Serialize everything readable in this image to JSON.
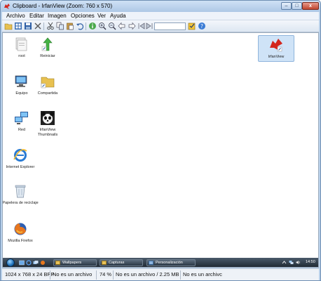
{
  "window": {
    "title": "Clipboard - IrfanView (Zoom: 760 x 570)",
    "controls": {
      "minimize": "–",
      "maximize": "□",
      "close": "x"
    }
  },
  "menu": [
    "Archivo",
    "Editar",
    "Imagen",
    "Opciones",
    "Ver",
    "Ayuda"
  ],
  "toolbar": {
    "buttons": [
      "open-folder",
      "thumbnails",
      "save",
      "delete",
      "cut",
      "copy",
      "paste",
      "undo",
      "info",
      "zoom-in",
      "zoom-out",
      "previous",
      "next",
      "first",
      "last",
      "options",
      "help"
    ],
    "field_value": ""
  },
  "desktop": {
    "icons": [
      {
        "name": "root",
        "label": "root"
      },
      {
        "name": "reiniciar",
        "label": "Reiniciar"
      },
      {
        "name": "irfanview",
        "label": "IrfanView"
      },
      {
        "name": "equipo",
        "label": "Equipo"
      },
      {
        "name": "compartida",
        "label": "Compartida"
      },
      {
        "name": "red",
        "label": "Red"
      },
      {
        "name": "irfanview-thumbnails",
        "label": "IrfanView Thumbnails"
      },
      {
        "name": "internet-explorer",
        "label": "Internet Explorer"
      },
      {
        "name": "papelera",
        "label": "Papelera de reciclaje"
      },
      {
        "name": "firefox",
        "label": "Mozilla Firefox"
      }
    ],
    "taskbar": {
      "tasks": [
        "Wallpapers",
        "Capturas",
        "Personalización"
      ],
      "clock": "14:50"
    }
  },
  "status": {
    "dimensions": "1024 x 768 x 24 BPP",
    "file": "No es un archivo",
    "zoom": "74 %",
    "file_size": "No es un archivo / 2.25 MB",
    "file_tail": "No es un archivc"
  },
  "colors": {
    "accent": "#1c6fb8",
    "titlebar": "#b9d1ea",
    "close": "#c0462f"
  }
}
